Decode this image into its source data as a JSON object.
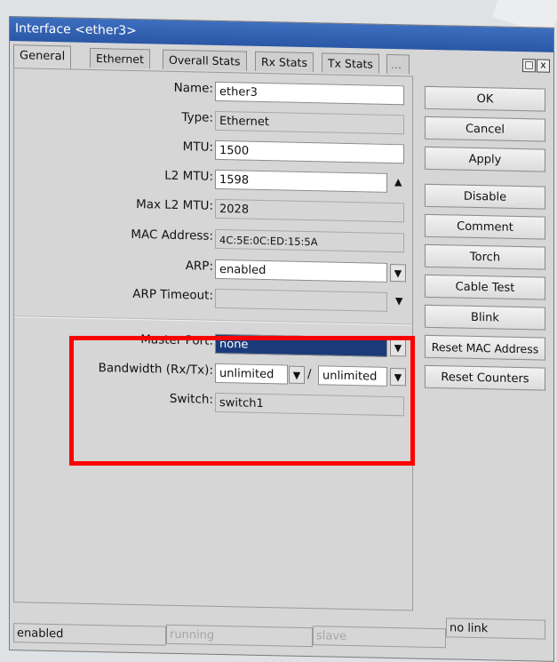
{
  "window": {
    "title": "Interface <ether3>",
    "controls": {
      "restore": "□",
      "close": "x"
    }
  },
  "tabs": [
    "General",
    "Ethernet",
    "Overall Stats",
    "Rx Stats",
    "Tx Stats",
    "..."
  ],
  "form": {
    "name": {
      "label": "Name:",
      "value": "ether3"
    },
    "type": {
      "label": "Type:",
      "value": "Ethernet"
    },
    "mtu": {
      "label": "MTU:",
      "value": "1500"
    },
    "l2mtu": {
      "label": "L2 MTU:",
      "value": "1598"
    },
    "max_l2mtu": {
      "label": "Max L2 MTU:",
      "value": "2028"
    },
    "mac": {
      "label": "MAC Address:",
      "value": "4C:5E:0C:ED:15:5A"
    },
    "arp": {
      "label": "ARP:",
      "value": "enabled"
    },
    "arp_timeout": {
      "label": "ARP Timeout:",
      "value": ""
    },
    "master_port": {
      "label": "Master Port:",
      "value": "none"
    },
    "bandwidth": {
      "label": "Bandwidth (Rx/Tx):",
      "rx": "unlimited",
      "separator": "/",
      "tx": "unlimited"
    },
    "switch": {
      "label": "Switch:",
      "value": "switch1"
    }
  },
  "buttons": {
    "ok": "OK",
    "cancel": "Cancel",
    "apply": "Apply",
    "disable": "Disable",
    "comment": "Comment",
    "torch": "Torch",
    "cable_test": "Cable Test",
    "blink": "Blink",
    "reset_mac": "Reset MAC Address",
    "reset_counters": "Reset Counters"
  },
  "statusbar": {
    "state": "enabled",
    "running": "running",
    "slave": "slave",
    "link": "no link"
  },
  "highlight_color": "#ff0000"
}
